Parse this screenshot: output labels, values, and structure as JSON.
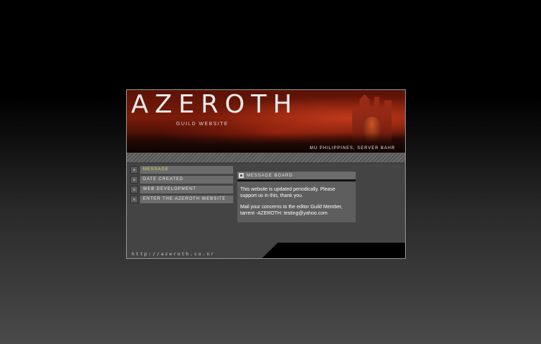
{
  "banner": {
    "title": "AZEROTH",
    "subtitle": "GUILD WEBSITE",
    "server": "MU PHILIPPINES, SERVER BAHR"
  },
  "nav": {
    "items": [
      {
        "label": "MESSAGE",
        "active": true
      },
      {
        "label": "DATE CREATED",
        "active": false
      },
      {
        "label": "WEB DEVELOPMENT",
        "active": false
      },
      {
        "label": "ENTER THE AZEROTH WEBSITE",
        "active": false
      }
    ]
  },
  "board": {
    "title": "MESSAGE BOARD",
    "paragraphs": [
      "This website is updated periodically. Please support us in this, thank you.",
      "Mail your concerns to the editor Guild Member, tarrent -AZEROTH: testing@yahoo.com"
    ]
  },
  "footer": {
    "url": "http://azeroth.co.nr"
  },
  "colors": {
    "active_nav": "#e8d86a",
    "banner_red": "#7a1c0a"
  }
}
